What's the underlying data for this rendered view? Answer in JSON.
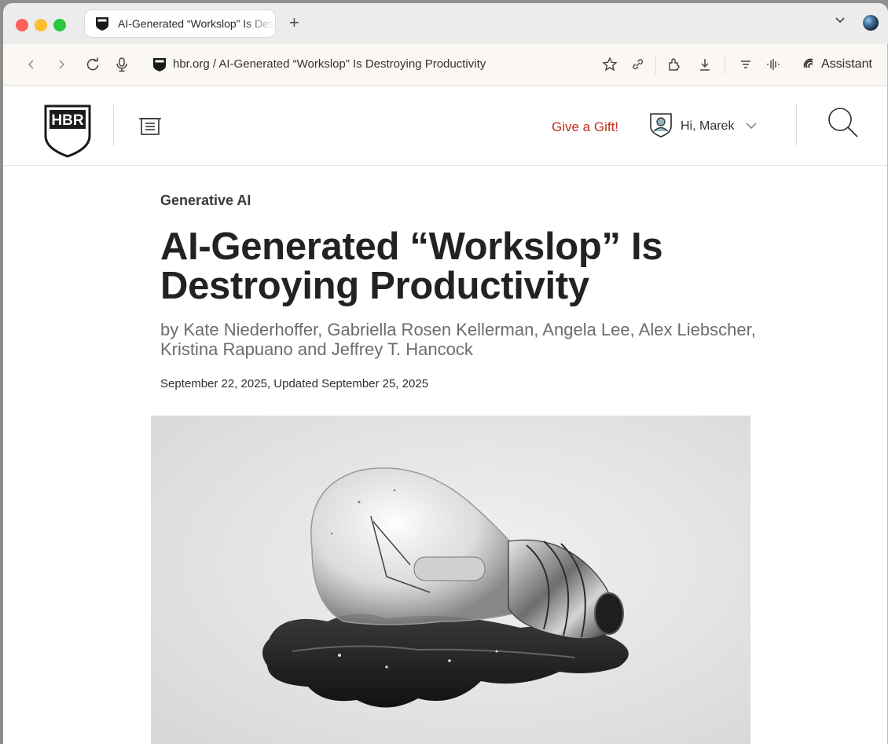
{
  "browser": {
    "tab": {
      "title": "AI-Generated “Workslop” Is Destroying Productivity"
    },
    "new_tab_label": "+",
    "address": {
      "host": "hbr.org",
      "separator": " / ",
      "page_title": "AI-Generated “Workslop” Is Destroying Productivity"
    },
    "assistant_label": "Assistant",
    "icons": [
      "back-icon",
      "forward-icon",
      "reload-icon",
      "microphone-icon",
      "bookmark-star-icon",
      "share-link-icon",
      "extensions-icon",
      "download-icon",
      "reader-view-icon",
      "voice-icon",
      "assistant-icon"
    ]
  },
  "site": {
    "logo_text": "HBR",
    "gift_label": "Give a Gift!",
    "user_greeting": "Hi, Marek",
    "accent_color": "#c2301c"
  },
  "article": {
    "category": "Generative AI",
    "headline": "AI-Generated “Workslop” Is Destroying Productivity",
    "authors": "by Kate Niederhoffer, Gabriella Rosen Kellerman, Angela Lee, Alex Liebscher, Kristina Rapuano and Jeffrey T. Hancock",
    "date": "September 22, 2025, Updated September 25, 2025",
    "hero_image": "melting-light-bulb"
  }
}
